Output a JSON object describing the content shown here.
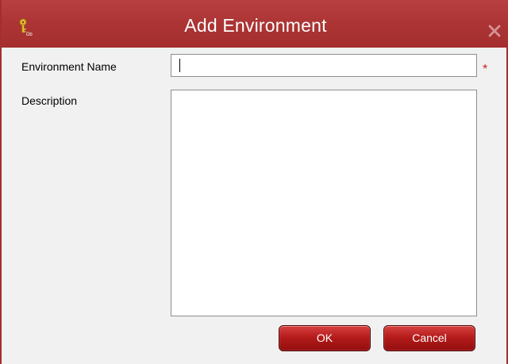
{
  "dialog": {
    "title": "Add Environment",
    "title_icon": "key-icon",
    "close_icon": "close-icon"
  },
  "form": {
    "name_label": "Environment Name",
    "name_value": "",
    "required_marker": "*",
    "description_label": "Description",
    "description_value": ""
  },
  "buttons": {
    "ok_label": "OK",
    "cancel_label": "Cancel"
  },
  "colors": {
    "titlebar": "#a93232",
    "required": "#cc1f1f",
    "button": "#b31a1a"
  }
}
